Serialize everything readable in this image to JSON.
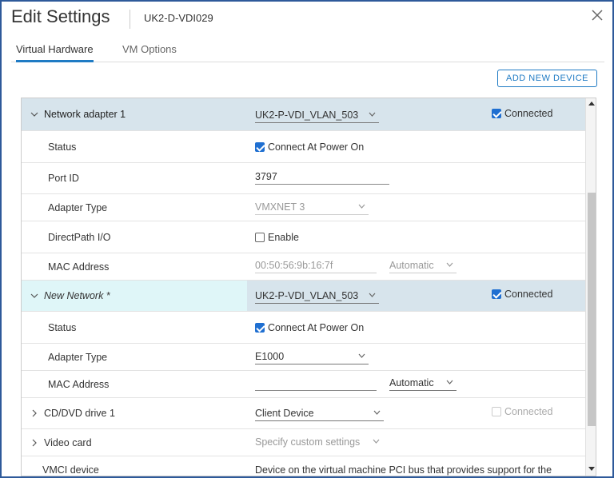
{
  "header": {
    "title": "Edit Settings",
    "vm_name": "UK2-D-VDI029"
  },
  "tabs": [
    {
      "label": "Virtual Hardware",
      "active": true
    },
    {
      "label": "VM Options",
      "active": false
    }
  ],
  "toolbar": {
    "add_device_label": "ADD NEW DEVICE"
  },
  "network_adapter_1": {
    "label": "Network adapter 1",
    "network": "UK2-P-VDI_VLAN_503",
    "connected_label": "Connected",
    "connected": true,
    "status_label": "Status",
    "status_value": "Connect At Power On",
    "port_id_label": "Port ID",
    "port_id_value": "3797",
    "adapter_type_label": "Adapter Type",
    "adapter_type_value": "VMXNET 3",
    "directpath_label": "DirectPath I/O",
    "directpath_value": "Enable",
    "mac_label": "MAC Address",
    "mac_value": "00:50:56:9b:16:7f",
    "mac_mode": "Automatic"
  },
  "new_network": {
    "label": "New Network *",
    "network": "UK2-P-VDI_VLAN_503",
    "connected_label": "Connected",
    "connected": true,
    "status_label": "Status",
    "status_value": "Connect At Power On",
    "adapter_type_label": "Adapter Type",
    "adapter_type_value": "E1000",
    "mac_label": "MAC Address",
    "mac_value": "",
    "mac_mode": "Automatic"
  },
  "cd_dvd": {
    "label": "CD/DVD drive 1",
    "value": "Client Device",
    "connected_label": "Connected",
    "connected": false
  },
  "video_card": {
    "label": "Video card",
    "value": "Specify custom settings"
  },
  "vmci": {
    "label": "VMCI device",
    "value": "Device on the virtual machine PCI bus that provides support for the"
  },
  "colors": {
    "accent": "#1f7bc4",
    "section_bg": "#d7e4ec",
    "new_item_bg": "#dff6f8",
    "border": "#2e5a9a"
  }
}
